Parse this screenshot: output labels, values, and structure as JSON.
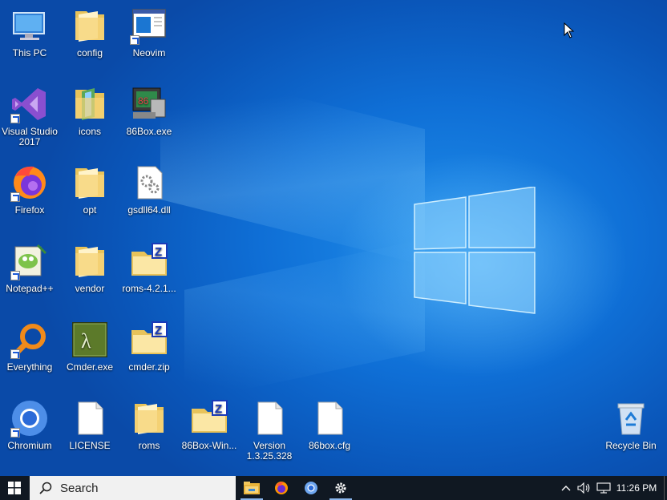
{
  "desktop": {
    "icons": [
      {
        "label": "This PC",
        "kind": "pc",
        "shortcut": false
      },
      {
        "label": "config",
        "kind": "folder",
        "shortcut": false
      },
      {
        "label": "Neovim",
        "kind": "neovim",
        "shortcut": true
      },
      {
        "label": "Visual Studio 2017",
        "kind": "vs",
        "shortcut": true
      },
      {
        "label": "icons",
        "kind": "folder-green",
        "shortcut": false
      },
      {
        "label": "86Box.exe",
        "kind": "86box",
        "shortcut": false
      },
      {
        "label": "Firefox",
        "kind": "firefox",
        "shortcut": true
      },
      {
        "label": "opt",
        "kind": "folder",
        "shortcut": false
      },
      {
        "label": "gsdll64.dll",
        "kind": "dll",
        "shortcut": false
      },
      {
        "label": "Notepad++",
        "kind": "notepadpp",
        "shortcut": true
      },
      {
        "label": "vendor",
        "kind": "folder",
        "shortcut": false
      },
      {
        "label": "roms-4.2.1...",
        "kind": "zip",
        "shortcut": false
      },
      {
        "label": "Everything",
        "kind": "everything",
        "shortcut": true
      },
      {
        "label": "Cmder.exe",
        "kind": "cmder",
        "shortcut": false
      },
      {
        "label": "cmder.zip",
        "kind": "zip",
        "shortcut": false
      },
      {
        "label": "Chromium",
        "kind": "chromium",
        "shortcut": true
      },
      {
        "label": "LICENSE",
        "kind": "file",
        "shortcut": false
      },
      {
        "label": "roms",
        "kind": "folder",
        "shortcut": false
      },
      {
        "label": "86Box-Win...",
        "kind": "zip",
        "shortcut": false
      },
      {
        "label": "Version 1.3.25.328",
        "kind": "file",
        "shortcut": false
      },
      {
        "label": "86box.cfg",
        "kind": "file",
        "shortcut": false
      },
      {
        "label": "Recycle Bin",
        "kind": "recycle",
        "shortcut": false
      }
    ]
  },
  "taskbar": {
    "search_placeholder": "Search",
    "pinned": [
      "file-explorer-icon",
      "firefox-icon",
      "chromium-icon",
      "settings-icon"
    ],
    "tray": {
      "time": "11:26 PM"
    }
  },
  "colors": {
    "accent": "#0a6fd8",
    "taskbar": "#101822"
  }
}
